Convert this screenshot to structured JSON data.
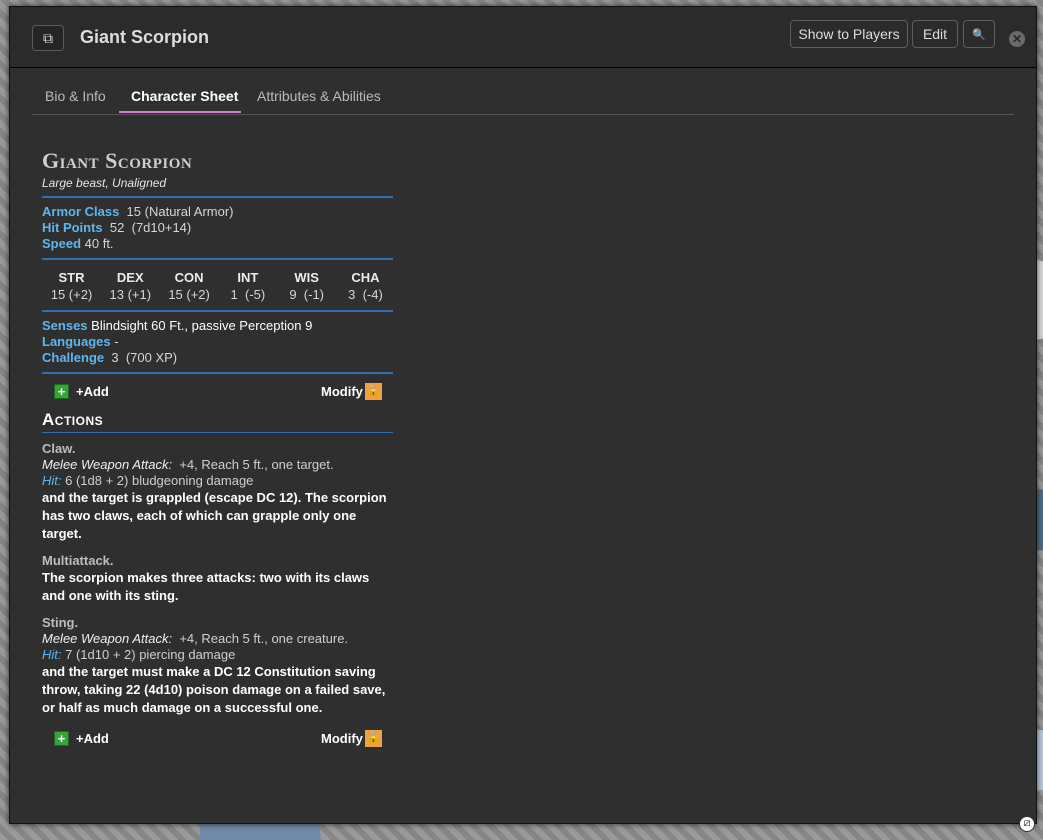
{
  "window": {
    "title": "Giant Scorpion",
    "popout_icon": "⧉",
    "buttons": {
      "show_to_players": "Show to Players",
      "edit": "Edit",
      "search_icon": "🔍"
    },
    "close_icon": "✕"
  },
  "tabs": [
    {
      "label": "Bio & Info"
    },
    {
      "label": "Character Sheet"
    },
    {
      "label": "Attributes & Abilities"
    }
  ],
  "monster": {
    "name": "Giant Scorpion",
    "subtitle": "Large beast, Unaligned",
    "armor_class": {
      "label": "Armor Class",
      "value": "15",
      "note": "(Natural Armor)"
    },
    "hit_points": {
      "label": "Hit Points",
      "value": "52",
      "dice": "(7d10+14)"
    },
    "speed": {
      "label": "Speed",
      "value": "40 ft."
    },
    "abilities": [
      {
        "name": "STR",
        "value": "15 (+2)"
      },
      {
        "name": "DEX",
        "value": "13 (+1)"
      },
      {
        "name": "CON",
        "value": "15 (+2)"
      },
      {
        "name": "INT",
        "value": "1  (-5)"
      },
      {
        "name": "WIS",
        "value": "9  (-1)"
      },
      {
        "name": "CHA",
        "value": "3  (-4)"
      }
    ],
    "senses": {
      "label": "Senses",
      "value": "Blindsight 60 Ft., passive Perception 9"
    },
    "languages": {
      "label": "Languages",
      "value": "-"
    },
    "challenge": {
      "label": "Challenge",
      "value": "3",
      "xp": "(700 XP)"
    }
  },
  "controls": {
    "add_label": "+Add",
    "modify_label": "Modify",
    "plus_icon": "+",
    "lock_icon": "🔒"
  },
  "actions_heading": "Actions",
  "actions": [
    {
      "name": "Claw.",
      "attack_type": "Melee Weapon Attack:",
      "attack_detail": "+4, Reach 5 ft.,  one target.",
      "hit_label": "Hit:",
      "hit_detail": "6 (1d8 + 2) bludgeoning damage",
      "description": "and the target is grappled (escape DC 12). The scorpion has two claws, each of which can grapple only one target."
    },
    {
      "name": "Multiattack.",
      "description": "The scorpion makes three attacks: two with its claws and one with its sting."
    },
    {
      "name": "Sting.",
      "attack_type": "Melee Weapon Attack:",
      "attack_detail": "+4, Reach 5 ft.,  one creature.",
      "hit_label": "Hit:",
      "hit_detail": "7 (1d10 + 2) piercing damage",
      "description": "and the target must make a DC 12 Constitution saving throw, taking 22 (4d10) poison damage on a failed save, or half as much damage on a successful one."
    }
  ],
  "resize_icon": "⧄"
}
